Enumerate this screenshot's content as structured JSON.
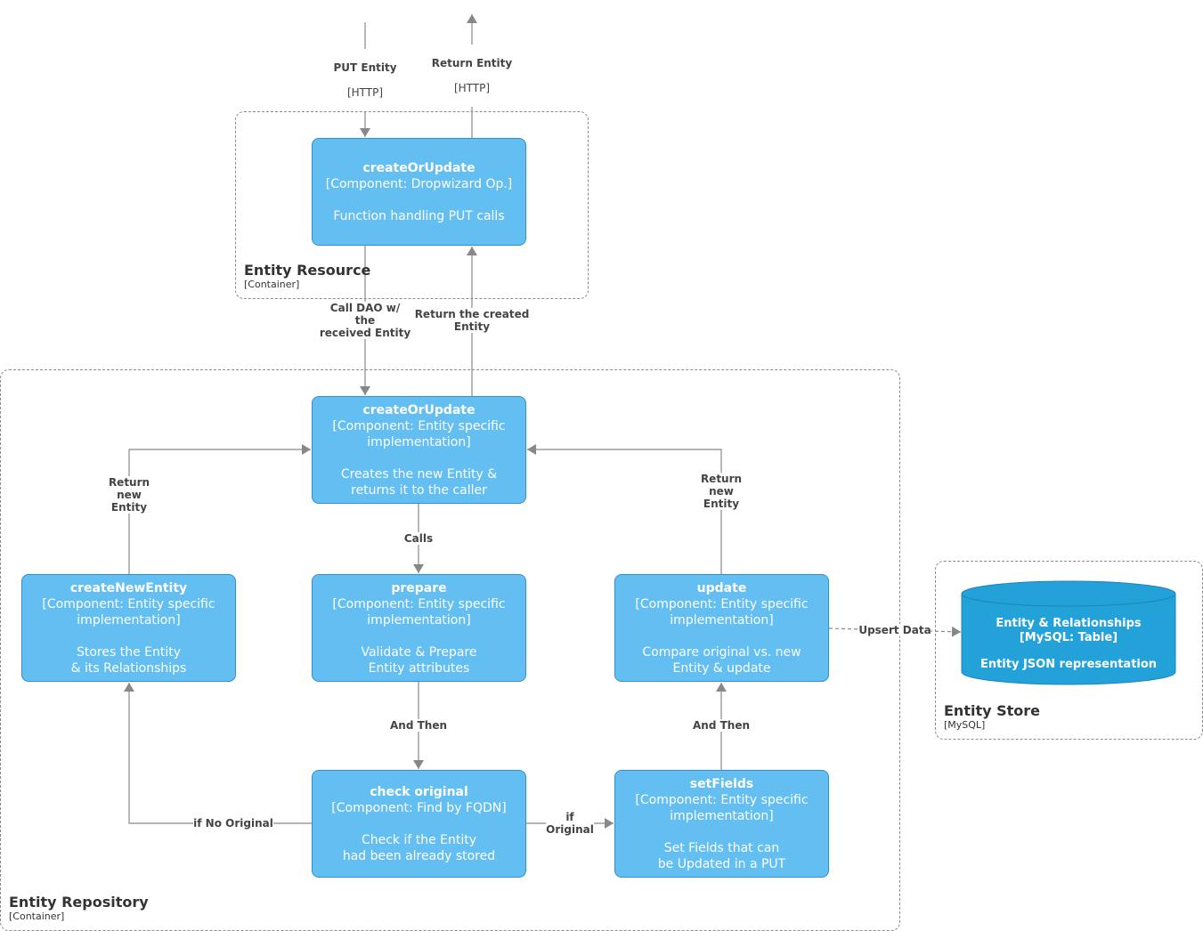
{
  "boundaries": {
    "resource": {
      "title": "Entity Resource",
      "subtitle": "[Container]"
    },
    "repository": {
      "title": "Entity Repository",
      "subtitle": "[Container]"
    },
    "store": {
      "title": "Entity Store",
      "subtitle": "[MySQL]"
    }
  },
  "components": {
    "resource_create_or_update": {
      "name": "createOrUpdate",
      "tech": "[Component: Dropwizard Op.]",
      "desc": "Function handling PUT calls"
    },
    "repo_create_or_update": {
      "name": "createOrUpdate",
      "tech": "[Component: Entity specific\nimplementation]",
      "desc": "Creates the new Entity &\nreturns it to the caller"
    },
    "create_new_entity": {
      "name": "createNewEntity",
      "tech": "[Component: Entity specific\nimplementation]",
      "desc": "Stores the Entity\n& its Relationships"
    },
    "prepare": {
      "name": "prepare",
      "tech": "[Component: Entity specific\nimplementation]",
      "desc": "Validate & Prepare\nEntity attributes"
    },
    "update": {
      "name": "update",
      "tech": "[Component: Entity specific\nimplementation]",
      "desc": "Compare original vs. new\nEntity & update"
    },
    "check_original": {
      "name": "check original",
      "tech": "[Component: Find by FQDN]",
      "desc": "Check if the Entity\nhad been already stored"
    },
    "set_fields": {
      "name": "setFields",
      "tech": "[Component: Entity specific\nimplementation]",
      "desc": "Set Fields that can\nbe Updated in a PUT"
    }
  },
  "database": {
    "name": "Entity & Relationships",
    "tech": "[MySQL: Table]",
    "desc": "Entity JSON representation"
  },
  "edges": {
    "put_entity": {
      "label": "PUT Entity",
      "tech": "[HTTP]"
    },
    "return_entity": {
      "label": "Return Entity",
      "tech": "[HTTP]"
    },
    "call_dao": {
      "label": "Call DAO w/\nthe\nreceived Entity"
    },
    "return_created": {
      "label": "Return the created\nEntity"
    },
    "calls": {
      "label": "Calls"
    },
    "return_new_left": {
      "label": "Return\nnew\nEntity"
    },
    "return_new_right": {
      "label": "Return\nnew\nEntity"
    },
    "and_then_left": {
      "label": "And Then"
    },
    "and_then_right": {
      "label": "And Then"
    },
    "if_no_original": {
      "label": "if No Original"
    },
    "if_original": {
      "label": "if\nOriginal"
    },
    "upsert": {
      "label": "Upsert Data"
    }
  }
}
